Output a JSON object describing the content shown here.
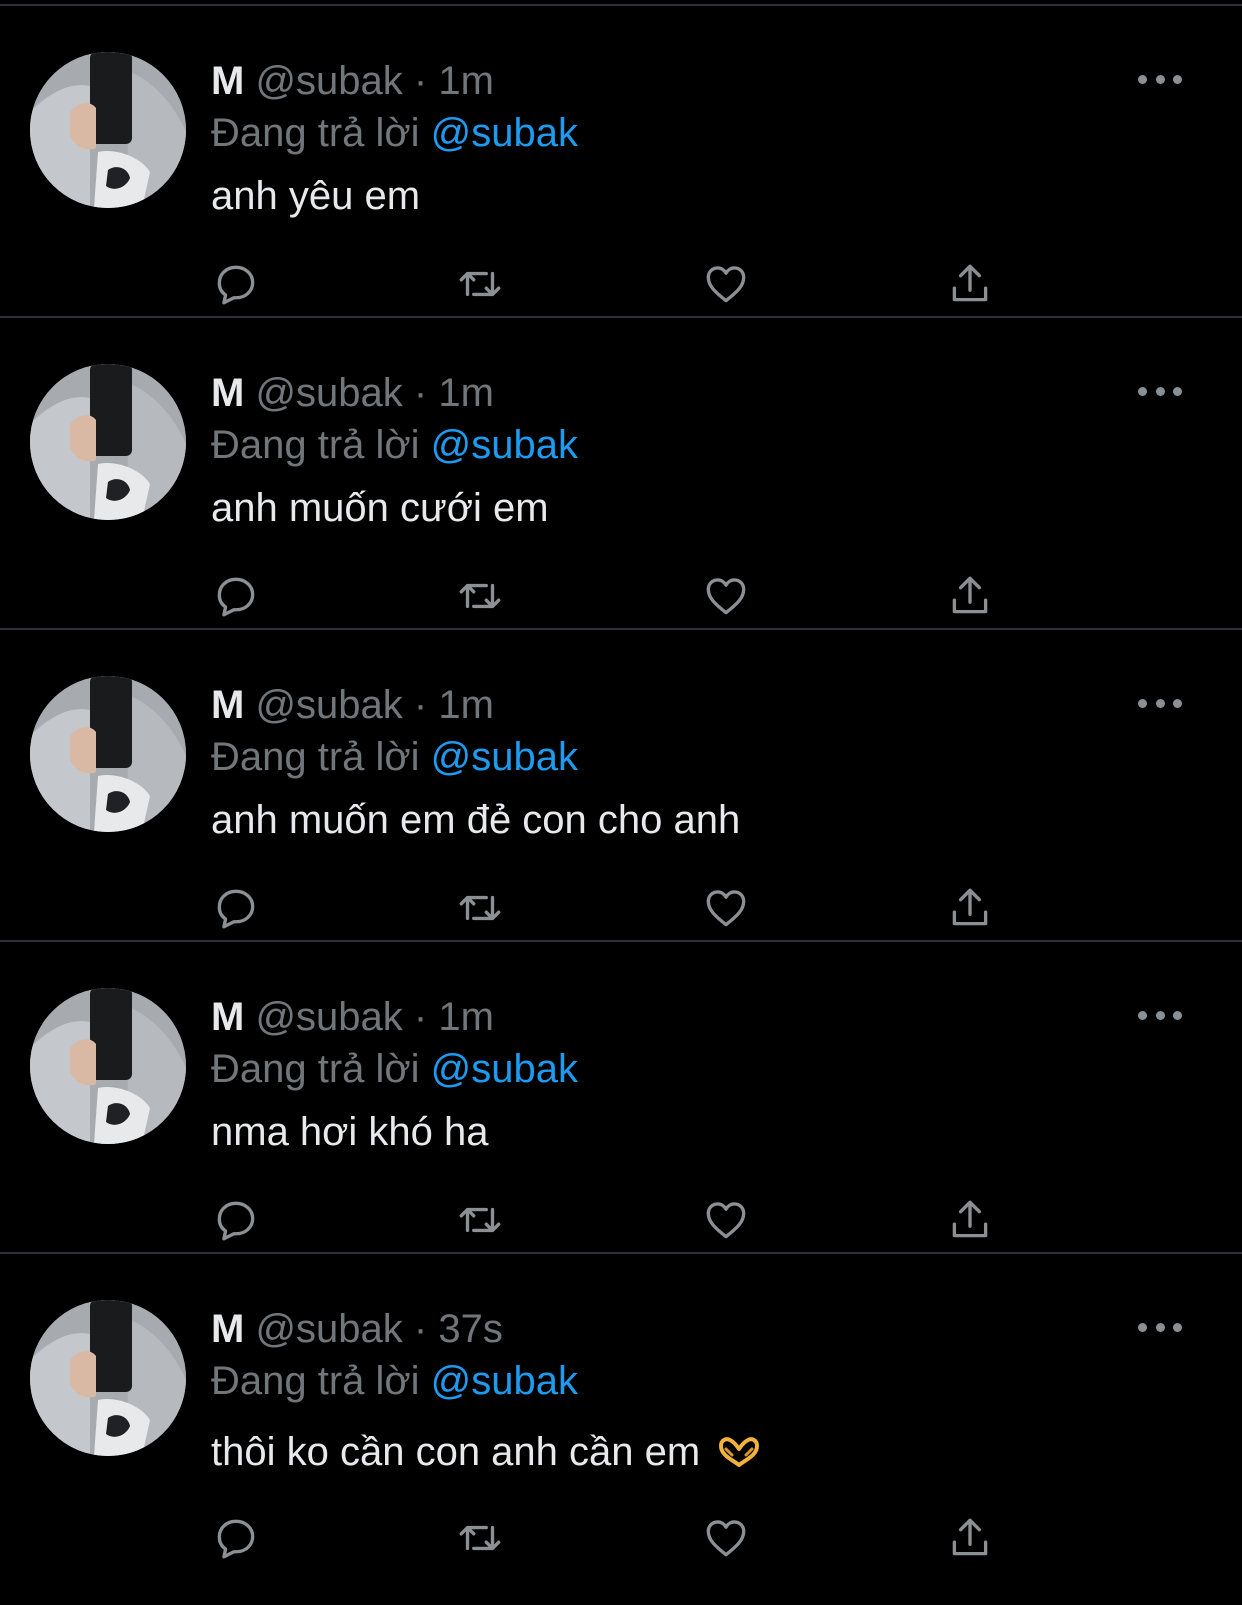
{
  "theme": {
    "background": "#000000",
    "text": "#e7e9ea",
    "muted": "#71767b",
    "accent": "#1d9bf0",
    "divider": "#2f3336"
  },
  "icons": {
    "more": "more-horizontal-icon",
    "reply": "reply-icon",
    "retweet": "retweet-icon",
    "like": "heart-icon",
    "share": "share-icon"
  },
  "tweets": [
    {
      "name": "M",
      "handle": "@subak",
      "separator": "·",
      "time": "1m",
      "reply_prefix": "Đang trả lời",
      "reply_to": "@subak",
      "text": "anh yêu em"
    },
    {
      "name": "M",
      "handle": "@subak",
      "separator": "·",
      "time": "1m",
      "reply_prefix": "Đang trả lời",
      "reply_to": "@subak",
      "text": "anh muốn cưới em"
    },
    {
      "name": "M",
      "handle": "@subak",
      "separator": "·",
      "time": "1m",
      "reply_prefix": "Đang trả lời",
      "reply_to": "@subak",
      "text": "anh muốn em đẻ con cho anh"
    },
    {
      "name": "M",
      "handle": "@subak",
      "separator": "·",
      "time": "1m",
      "reply_prefix": "Đang trả lời",
      "reply_to": "@subak",
      "text": "nma hơi khó ha"
    },
    {
      "name": "M",
      "handle": "@subak",
      "separator": "·",
      "time": "37s",
      "reply_prefix": "Đang trả lời",
      "reply_to": "@subak",
      "text": "thôi ko cần con anh cần em",
      "emoji": "heart-hands-emoji"
    }
  ]
}
